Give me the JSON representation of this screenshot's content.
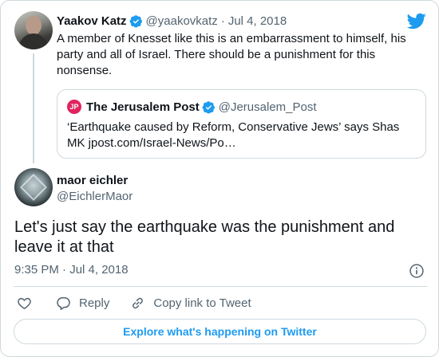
{
  "parent_tweet": {
    "author_name": "Yaakov Katz",
    "author_handle": "@yaakovkatz",
    "separator": "·",
    "date": "Jul 4, 2018",
    "text": "A member of Knesset like this is an embarrassment to himself, his party and all of Israel. There should be a punishment for this nonsense."
  },
  "quote_tweet": {
    "logo_text": "JP",
    "author_name": "The Jerusalem Post",
    "author_handle": "@Jerusalem_Post",
    "text": "‘Earthquake caused by Reform, Conservative Jews’ says Shas MK jpost.com/Israel-News/Po…"
  },
  "main_tweet": {
    "author_name": "maor eichler",
    "author_handle": "@EichlerMaor",
    "text": "Let's just say the earthquake was the punishment and leave it at that",
    "timestamp": "9:35 PM · Jul 4, 2018"
  },
  "actions": {
    "reply_label": "Reply",
    "copy_link_label": "Copy link to Tweet"
  },
  "explore_label": "Explore what's happening on Twitter",
  "colors": {
    "accent": "#1d9bf0",
    "text": "#0f1419",
    "muted": "#536471",
    "border": "#cfd9de",
    "jpost_red": "#e0245e"
  },
  "icons": {
    "verified": "verified-badge-icon",
    "brand": "twitter-bird-icon",
    "info": "info-icon",
    "like": "heart-icon",
    "reply": "speech-bubble-icon",
    "copy_link": "link-icon"
  }
}
